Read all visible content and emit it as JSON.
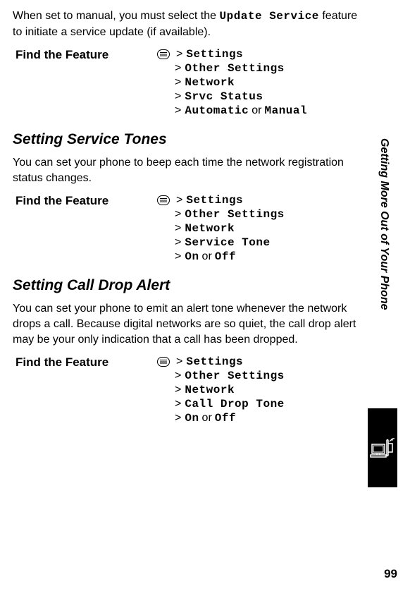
{
  "intro": {
    "text_before": "When set to manual, you must select the ",
    "mono": "Update Service",
    "text_after": " feature to initiate a service update (if available)."
  },
  "feature_label": "Find the Feature",
  "block1": {
    "l1": "Settings",
    "l2": "Other Settings",
    "l3": "Network",
    "l4": "Srvc Status",
    "l5a": "Automatic",
    "l5or": "or",
    "l5b": "Manual"
  },
  "section1": {
    "heading": "Setting Service Tones",
    "body": "You can set your phone to beep each time the network registration status changes."
  },
  "block2": {
    "l1": "Settings",
    "l2": "Other Settings",
    "l3": "Network",
    "l4": "Service Tone",
    "l5a": "On",
    "l5or": "or",
    "l5b": "Off"
  },
  "section2": {
    "heading": "Setting Call Drop Alert",
    "body": "You can set your phone to emit an alert tone whenever the network drops a call. Because digital networks are so quiet, the call drop alert may be your only indication that a call has been dropped."
  },
  "block3": {
    "l1": "Settings",
    "l2": "Other Settings",
    "l3": "Network",
    "l4": "Call Drop Tone",
    "l5a": "On",
    "l5or": "or",
    "l5b": "Off"
  },
  "side_label": "Getting More Out of Your Phone",
  "page_number": "99"
}
